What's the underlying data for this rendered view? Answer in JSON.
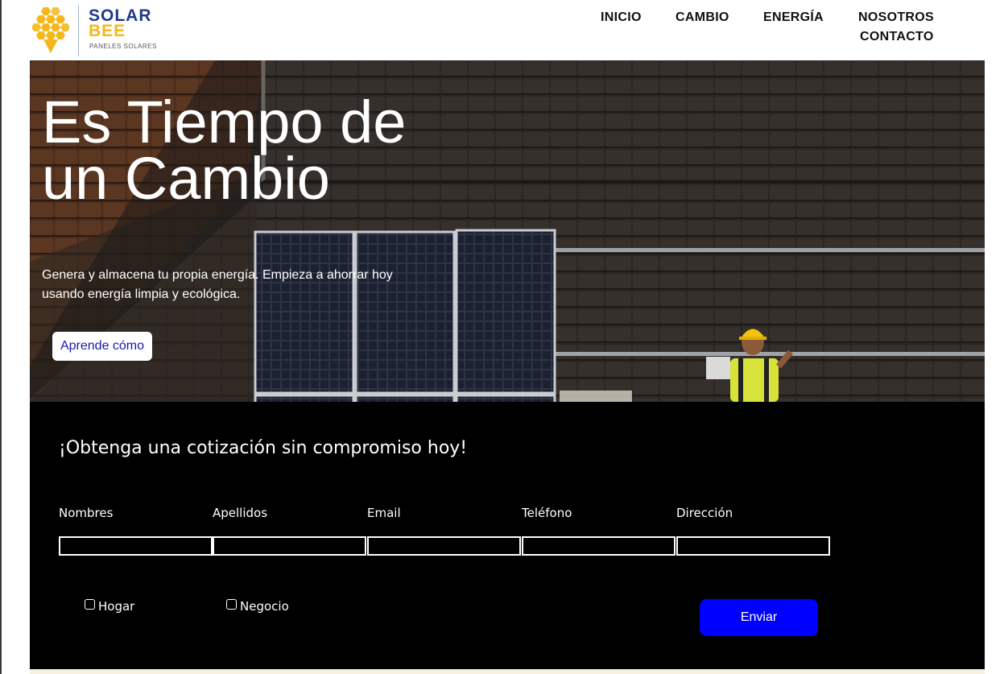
{
  "brand": {
    "name_line1": "SOLAR",
    "name_line2": "BEE",
    "tagline": "PANELES SOLARES",
    "colors": {
      "blue": "#1f3a8a",
      "yellow": "#f5b81a"
    },
    "icon": "honeycomb-logo-icon"
  },
  "nav": {
    "items": [
      {
        "label": "INICIO"
      },
      {
        "label": "CAMBIO"
      },
      {
        "label": "ENERGÍA"
      },
      {
        "label": "NOSOTROS"
      },
      {
        "label": "CONTACTO"
      }
    ]
  },
  "hero": {
    "title": "Es Tiempo de un Cambio",
    "subtitle": "Genera y almacena tu propia energía. Empieza a ahorrar hoy usando energía limpia y ecológica.",
    "cta_label": "Aprende cómo"
  },
  "quote_form": {
    "title": "¡Obtenga una cotización sin compromiso hoy!",
    "fields": [
      {
        "label": "Nombres",
        "value": ""
      },
      {
        "label": "Apellidos",
        "value": ""
      },
      {
        "label": "Email",
        "value": ""
      },
      {
        "label": "Teléfono",
        "value": ""
      },
      {
        "label": "Dirección",
        "value": ""
      }
    ],
    "checkboxes": [
      {
        "label": "Hogar",
        "checked": false
      },
      {
        "label": "Negocio",
        "checked": false
      }
    ],
    "submit_label": "Enviar",
    "submit_color": "#0000ff"
  }
}
